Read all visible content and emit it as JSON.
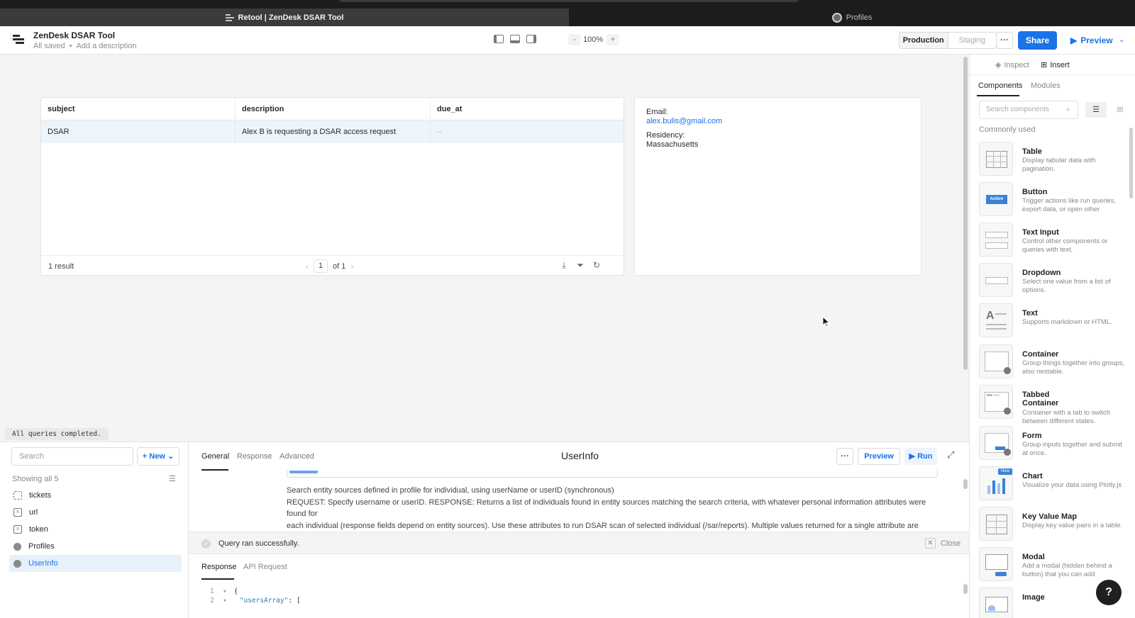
{
  "browser": {
    "active_tab": "Retool | ZenDesk DSAR Tool",
    "other_tab": "Profiles"
  },
  "app": {
    "title": "ZenDesk DSAR Tool",
    "saved_status": "All saved",
    "separator": "•",
    "description_placeholder": "Add a description",
    "zoom_out": "-",
    "zoom_level": "100%",
    "zoom_in": "+",
    "env_production": "Production",
    "env_staging": "Staging",
    "more": "···",
    "share": "Share",
    "preview": "Preview"
  },
  "table": {
    "columns": [
      "subject",
      "description",
      "due_at"
    ],
    "rows": [
      {
        "subject": "DSAR",
        "description": "Alex B is requesting a DSAR access request",
        "due_at": "–"
      }
    ],
    "result_count": "1 result",
    "page": "1",
    "page_of": "of 1"
  },
  "details": {
    "email_label": "Email:",
    "email_value": "alex.bulis@gmail.com",
    "residency_label": "Residency:",
    "residency_value": "Massachusetts"
  },
  "status": {
    "queries": "All queries completed."
  },
  "queries": {
    "search_placeholder": "Search",
    "new_label": "+ New",
    "showing": "Showing all 5",
    "items": [
      {
        "label": "tickets",
        "icon": "braces-icon"
      },
      {
        "label": "url",
        "icon": "variable-icon"
      },
      {
        "label": "token",
        "icon": "variable-icon"
      },
      {
        "label": "Profiles",
        "icon": "person-icon"
      },
      {
        "label": "UserInfo",
        "icon": "person-icon",
        "selected": true
      }
    ]
  },
  "editor": {
    "tabs": [
      "General",
      "Response",
      "Advanced"
    ],
    "title": "UserInfo",
    "more": "···",
    "preview": "Preview",
    "run": "Run",
    "desc_line1": "Search entity sources defined in profile for individual, using userName or userID (synchronous)",
    "desc_line2": "REQUEST: Specify username or userID. RESPONSE: Returns a list of individuals found in entity sources matching the search criteria, with whatever personal information attributes were found for",
    "desc_line3": "each individual (response fields depend on entity sources). Use these attributes to run DSAR scan of selected individual (/sar/reports). Multiple values returned for a single attribute are separated by",
    "desc_line4": "|.",
    "success": "Query ran successfully.",
    "close": "Close",
    "response_tabs": [
      "Response",
      "API Request"
    ],
    "code": [
      {
        "num": "1",
        "text": "{"
      },
      {
        "num": "2",
        "key": "\"usersArray\"",
        "rest": ": ["
      }
    ]
  },
  "right_panel": {
    "inspect": "Inspect",
    "insert": "Insert",
    "tab_components": "Components",
    "tab_modules": "Modules",
    "search_placeholder": "Search components",
    "commonly_used": "Commonly used",
    "components": [
      {
        "name": "Table",
        "desc": "Display tabular data with pagination."
      },
      {
        "name": "Button",
        "desc": "Trigger actions like run queries, export data, or open other"
      },
      {
        "name": "Text Input",
        "desc": "Control other components or queries with text."
      },
      {
        "name": "Dropdown",
        "desc": "Select one value from a list of options."
      },
      {
        "name": "Text",
        "desc": "Supports markdown or HTML."
      },
      {
        "name": "Container",
        "desc": "Group things together into groups, also nestable."
      },
      {
        "name": "Tabbed Container",
        "desc": "Container with a tab to switch between different states."
      },
      {
        "name": "Form",
        "desc": "Group inputs together and submit at once."
      },
      {
        "name": "Chart",
        "desc": "Visualize your data using Plotly.js",
        "badge": "New"
      },
      {
        "name": "Key Value Map",
        "desc": "Display key value pairs in a table."
      },
      {
        "name": "Modal",
        "desc": "Add a modal (hidden behind a button) that you can add"
      },
      {
        "name": "Image",
        "desc": ""
      }
    ],
    "button_thumb_label": "Action"
  },
  "help": "?"
}
